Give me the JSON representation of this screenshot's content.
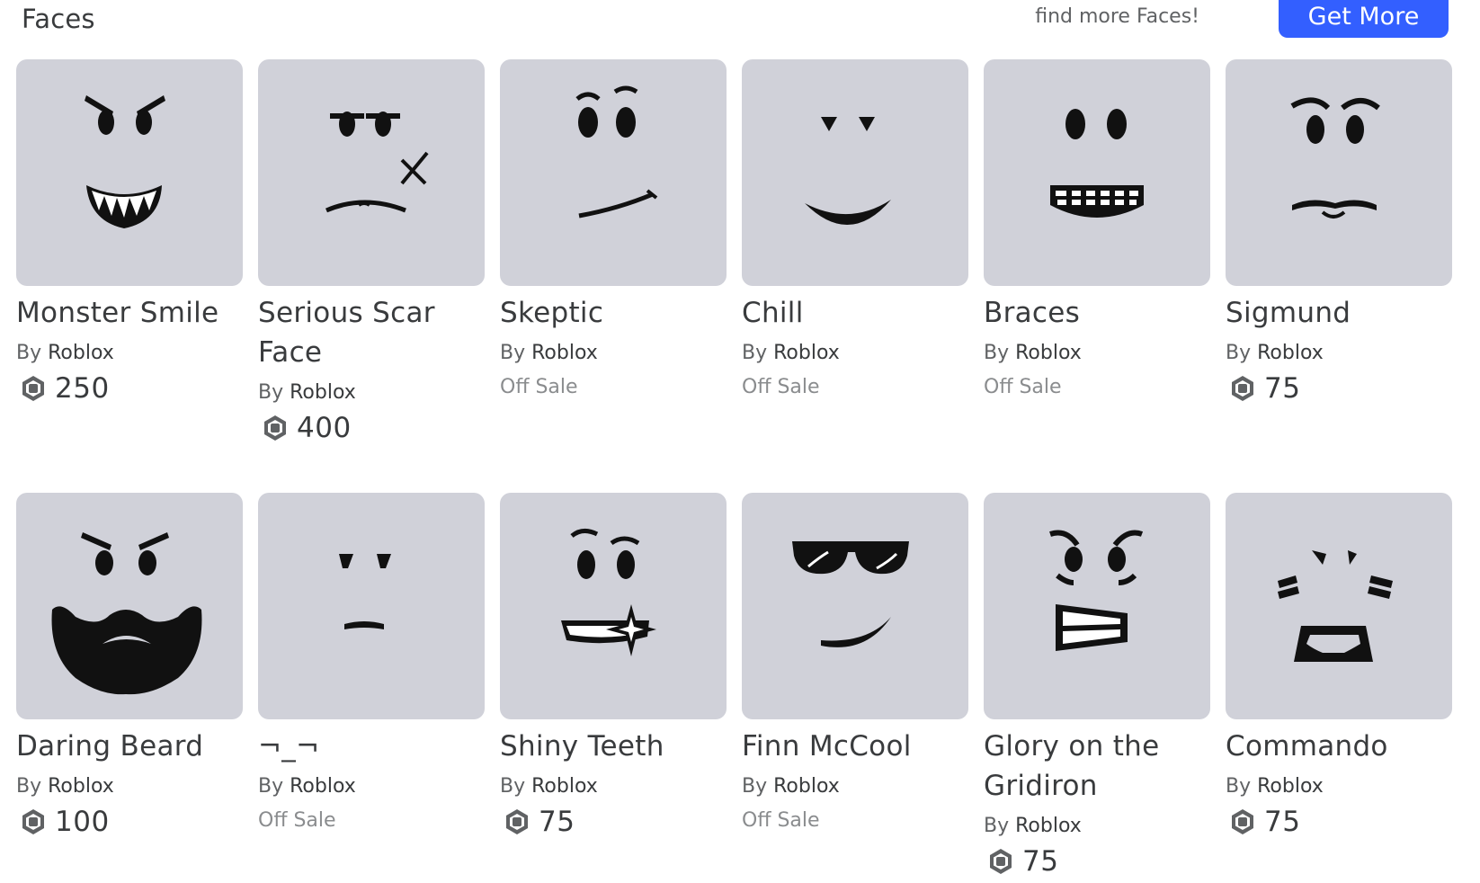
{
  "header": {
    "title": "Faces",
    "promo_text": "find more Faces!",
    "get_more_label": "Get More"
  },
  "items": [
    {
      "name": "Monster Smile",
      "by": "By",
      "creator": "Roblox",
      "price": "250",
      "off_sale": "",
      "icon": "monster-smile-face"
    },
    {
      "name": "Serious Scar Face",
      "by": "By",
      "creator": "Roblox",
      "price": "400",
      "off_sale": "",
      "icon": "serious-scar-face"
    },
    {
      "name": "Skeptic",
      "by": "By",
      "creator": "Roblox",
      "price": "",
      "off_sale": "Off Sale",
      "icon": "skeptic-face"
    },
    {
      "name": "Chill",
      "by": "By",
      "creator": "Roblox",
      "price": "",
      "off_sale": "Off Sale",
      "icon": "chill-face"
    },
    {
      "name": "Braces",
      "by": "By",
      "creator": "Roblox",
      "price": "",
      "off_sale": "Off Sale",
      "icon": "braces-face"
    },
    {
      "name": "Sigmund",
      "by": "By",
      "creator": "Roblox",
      "price": "75",
      "off_sale": "",
      "icon": "sigmund-face"
    },
    {
      "name": "Daring Beard",
      "by": "By",
      "creator": "Roblox",
      "price": "100",
      "off_sale": "",
      "icon": "daring-beard-face"
    },
    {
      "name": "¬_¬",
      "by": "By",
      "creator": "Roblox",
      "price": "",
      "off_sale": "Off Sale",
      "icon": "side-eye-face"
    },
    {
      "name": "Shiny Teeth",
      "by": "By",
      "creator": "Roblox",
      "price": "75",
      "off_sale": "",
      "icon": "shiny-teeth-face"
    },
    {
      "name": "Finn McCool",
      "by": "By",
      "creator": "Roblox",
      "price": "",
      "off_sale": "Off Sale",
      "icon": "sunglasses-face"
    },
    {
      "name": "Glory on the Gridiron",
      "by": "By",
      "creator": "Roblox",
      "price": "75",
      "off_sale": "",
      "icon": "gridiron-face"
    },
    {
      "name": "Commando",
      "by": "By",
      "creator": "Roblox",
      "price": "75",
      "off_sale": "",
      "icon": "commando-face"
    }
  ],
  "colors": {
    "accent": "#335fff",
    "thumb_bg": "#d0d1d9",
    "text": "#393b3d",
    "muted": "#606264"
  }
}
